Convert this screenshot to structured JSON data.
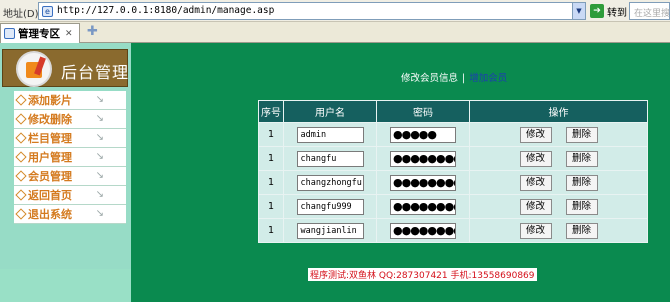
{
  "browser": {
    "address_label": "地址(D)",
    "url": "http://127.0.0.1:8180/admin/manage.asp",
    "go_label": "转到",
    "search_placeholder": "在这里搜",
    "tab_title": "管理专区"
  },
  "sidebar": {
    "title": "后台管理",
    "items": [
      {
        "label": "添加影片"
      },
      {
        "label": "修改删除"
      },
      {
        "label": "栏目管理"
      },
      {
        "label": "用户管理"
      },
      {
        "label": "会员管理"
      },
      {
        "label": "返回首页"
      },
      {
        "label": "退出系统"
      }
    ]
  },
  "main": {
    "links": {
      "edit": "修改会员信息",
      "separator": "|",
      "add": "增加会员"
    },
    "table": {
      "headers": [
        "序号",
        "用户名",
        "密码",
        "操作"
      ],
      "rows": [
        {
          "num": "1",
          "username": "admin",
          "password": "●●●●●"
        },
        {
          "num": "1",
          "username": "changfu",
          "password": "●●●●●●●●●"
        },
        {
          "num": "1",
          "username": "changzhongfu",
          "password": "●●●●●●●●●"
        },
        {
          "num": "1",
          "username": "changfu999",
          "password": "●●●●●●●●●"
        },
        {
          "num": "1",
          "username": "wangjianlin",
          "password": "●●●●●●●●●"
        }
      ],
      "edit_label": "修改",
      "delete_label": "删除"
    },
    "footer_note": "程序测试:双鱼林 QQ:287307421 手机:13558690869"
  }
}
